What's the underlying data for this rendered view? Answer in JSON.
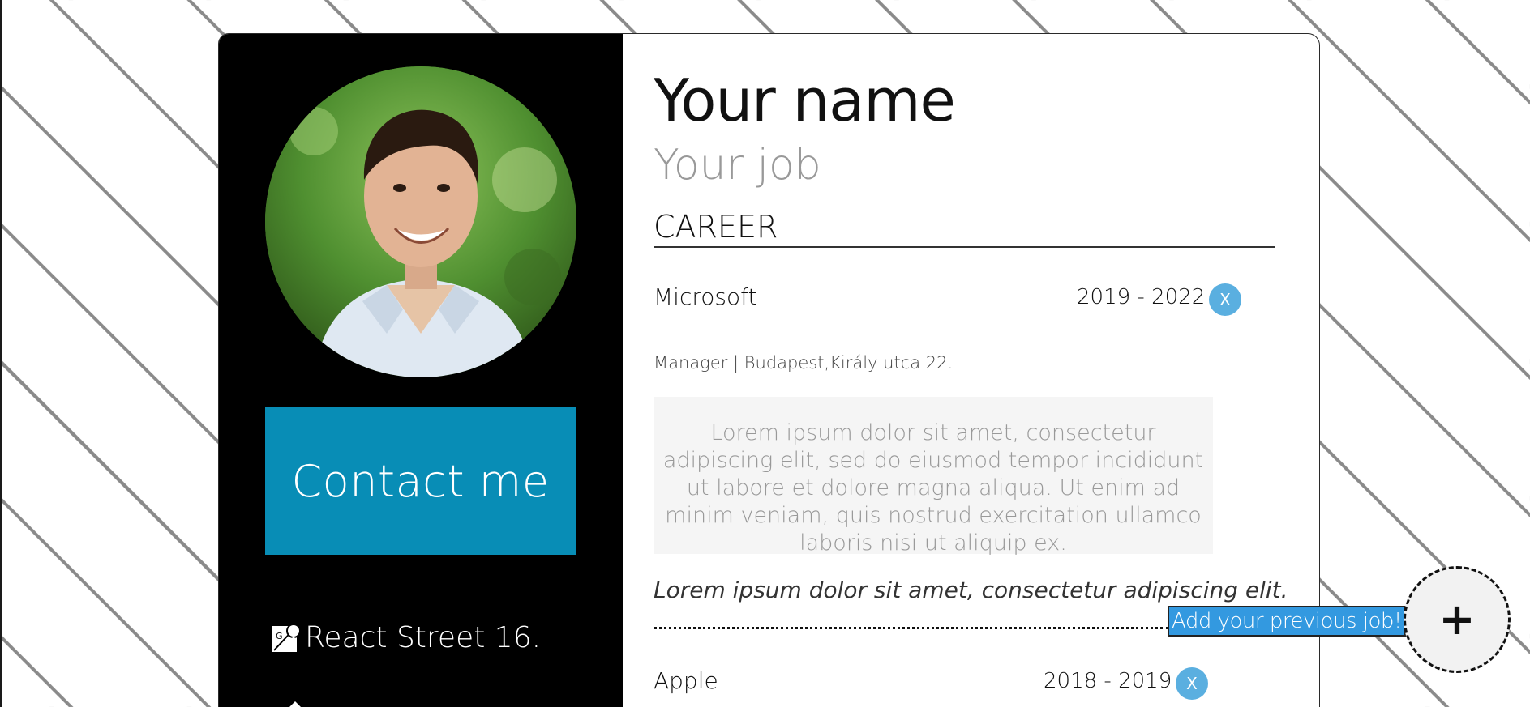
{
  "profile": {
    "name": "Your name",
    "job": "Your job",
    "avatar_icon": "person-photo"
  },
  "sidebar": {
    "contact_label": "Contact me",
    "address": "React Street 16.",
    "address_icon": "map-pin-icon"
  },
  "career": {
    "title": "CAREER",
    "jobs": [
      {
        "company": "Microsoft",
        "dates": "2019 - 2022",
        "remove_label": "X",
        "role": "Manager | Budapest,Király utca 22.",
        "description": "Lorem ipsum dolor sit amet, consectetur adipiscing elit, sed do eiusmod tempor incididunt ut labore et dolore magna aliqua. Ut enim ad minim veniam, quis nostrud exercitation ullamco laboris nisi ut aliquip ex.",
        "quote": "Lorem ipsum dolor sit amet, consectetur adipiscing elit."
      },
      {
        "company": "Apple",
        "dates": "2018 - 2019",
        "remove_label": "X"
      }
    ],
    "add_label": "Add your previous job!",
    "add_button": "+"
  },
  "colors": {
    "sidebar_bg": "#000000",
    "contact_bg": "#088db6",
    "remove_btn": "#5aafe0",
    "add_label_bg": "#3399e0"
  }
}
